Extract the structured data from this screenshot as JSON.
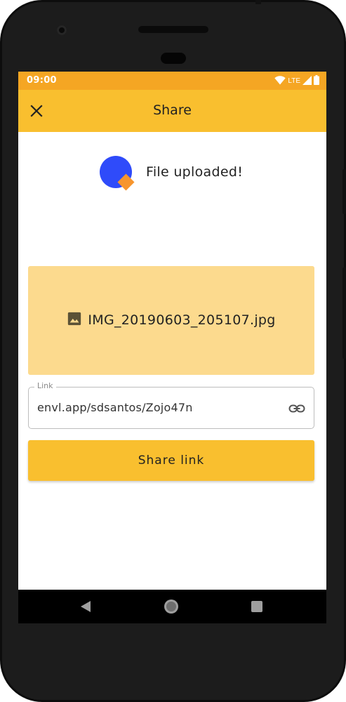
{
  "status_bar": {
    "time": "09:00",
    "network": "LTE"
  },
  "app_bar": {
    "title": "Share",
    "close_icon": "close-icon"
  },
  "upload": {
    "message": "File uploaded!",
    "logo": "app-logo"
  },
  "file": {
    "icon": "image-icon",
    "name": "IMG_20190603_205107.jpg"
  },
  "link_field": {
    "label": "Link",
    "value": "envl.app/sdsantos/Zojo47n",
    "icon": "link-icon"
  },
  "share_button": {
    "label": "Share link"
  },
  "nav_bar": {
    "back": "back-icon",
    "home": "home-icon",
    "recent": "recent-apps-icon"
  },
  "colors": {
    "status_bar": "#f5a623",
    "app_bar": "#f9bf2f",
    "file_card": "#fcda8e",
    "logo_circle": "#2f4bfa",
    "logo_diamond": "#f7952d"
  }
}
